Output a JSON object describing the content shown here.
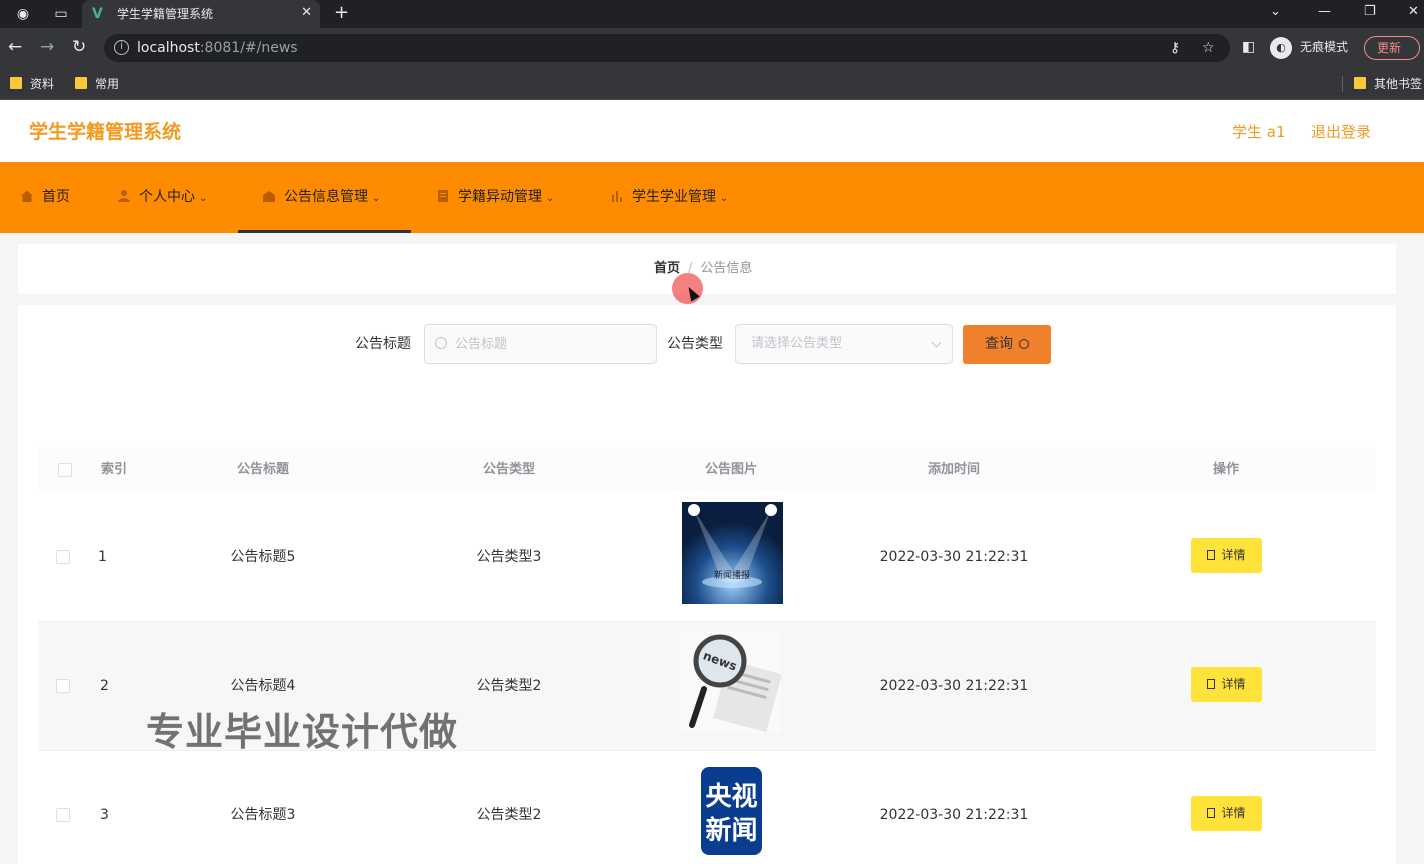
{
  "browser": {
    "tab_title": "学生学籍管理系统",
    "url_host": "localhost",
    "url_rest": ":8081/#/news",
    "incognito_label": "无痕模式",
    "update_label": "更新",
    "bookmarks": [
      "资料",
      "常用"
    ],
    "other_bookmarks": "其他书签"
  },
  "header": {
    "logo": "学生学籍管理系统",
    "user": "学生 a1",
    "logout": "退出登录"
  },
  "nav": {
    "items": [
      {
        "label": "首页",
        "icon": "home-icon"
      },
      {
        "label": "个人中心",
        "icon": "user-icon"
      },
      {
        "label": "公告信息管理",
        "icon": "notice-icon"
      },
      {
        "label": "学籍异动管理",
        "icon": "document-icon"
      },
      {
        "label": "学生学业管理",
        "icon": "bar-chart-icon"
      }
    ],
    "active_index": 2,
    "accent_color": "#ff8c00"
  },
  "breadcrumb": {
    "home": "首页",
    "separator": "/",
    "current": "公告信息"
  },
  "search": {
    "title_label": "公告标题",
    "title_placeholder": "公告标题",
    "type_label": "公告类型",
    "type_placeholder": "请选择公告类型",
    "query_label": "查询"
  },
  "table": {
    "columns": [
      "索引",
      "公告标题",
      "公告类型",
      "公告图片",
      "添加时间",
      "操作"
    ],
    "rows": [
      {
        "index": "1",
        "title": "公告标题5",
        "type": "公告类型3",
        "image": "news-spotlight-image",
        "time": "2022-03-30 21:22:31",
        "action": "详情"
      },
      {
        "index": "2",
        "title": "公告标题4",
        "type": "公告类型2",
        "image": "news-magnifier-image",
        "time": "2022-03-30 21:22:31",
        "action": "详情"
      },
      {
        "index": "3",
        "title": "公告标题3",
        "type": "公告类型2",
        "image": "cctv-news-logo-image",
        "time": "2022-03-30 21:22:31",
        "action": "详情"
      }
    ]
  },
  "images": {
    "spotlight_text": "新闻播报",
    "magnifier_text": "news",
    "cctv_line1": "央视",
    "cctv_line2": "新闻"
  },
  "watermark": "专业毕业设计代做"
}
